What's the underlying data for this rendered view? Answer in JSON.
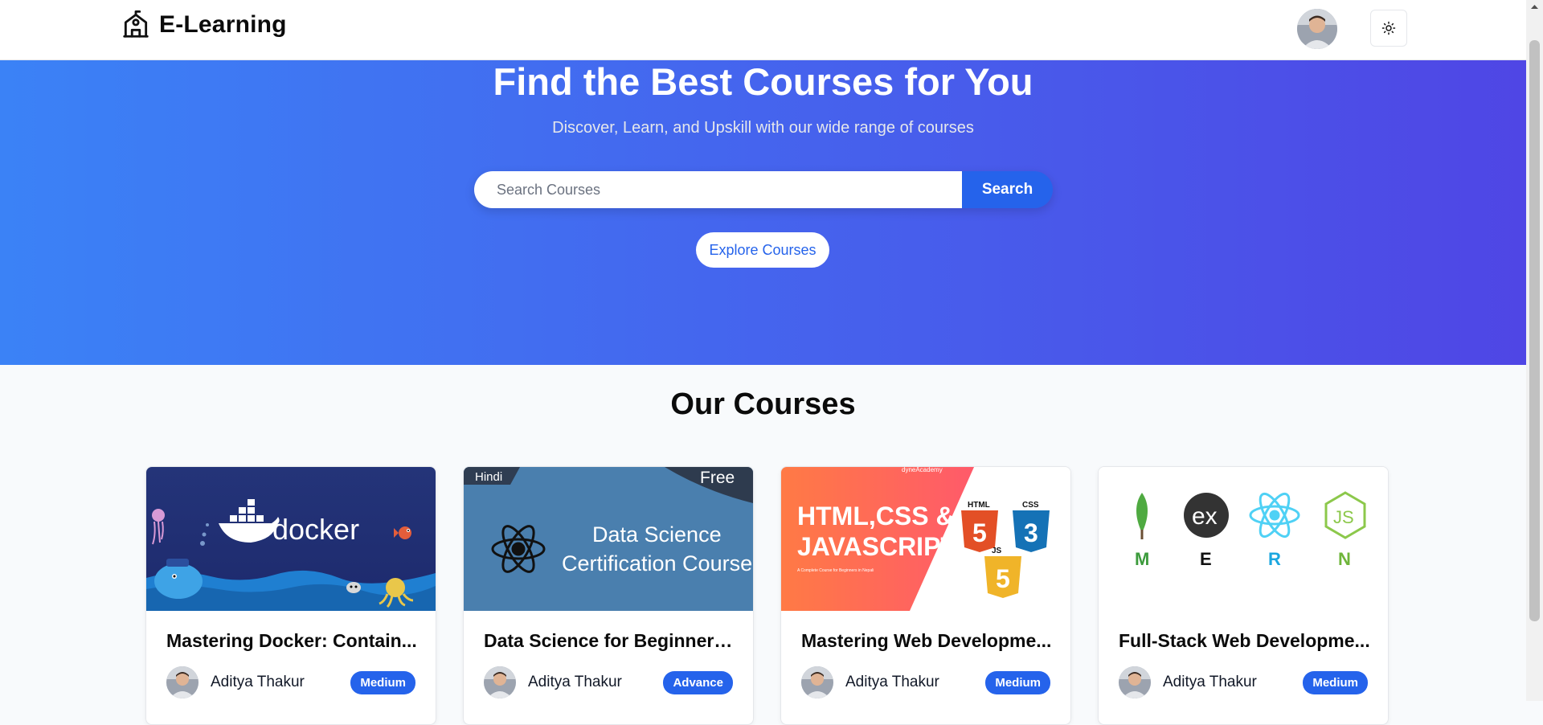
{
  "header": {
    "brand": "E-Learning",
    "avatar_icon": "user-avatar",
    "theme_icon": "sun-icon"
  },
  "hero": {
    "title": "Find the Best Courses for You",
    "subtitle": "Discover, Learn, and Upskill with our wide range of courses",
    "search_placeholder": "Search Courses",
    "search_button": "Search",
    "explore_button": "Explore Courses"
  },
  "courses": {
    "heading": "Our Courses",
    "items": [
      {
        "title": "Mastering Docker: Contain...",
        "author": "Aditya Thakur",
        "level": "Medium",
        "thumb": {
          "brand": "docker"
        }
      },
      {
        "title": "Data Science for Beginners:...",
        "author": "Aditya Thakur",
        "level": "Advance",
        "thumb": {
          "tag": "Hindi",
          "price": "Free",
          "line1": "Data Science",
          "line2": "Certification Course"
        }
      },
      {
        "title": "Mastering Web Developme...",
        "author": "Aditya Thakur",
        "level": "Medium",
        "thumb": {
          "brand": "dyneAcademy",
          "line1": "HTML,CSS &",
          "line2": "JAVASCRIPT",
          "caption": "A Complete Course for Beginners in Nepali",
          "html": "HTML",
          "css": "CSS",
          "js": "JS"
        }
      },
      {
        "title": "Full-Stack Web Developme...",
        "author": "Aditya Thakur",
        "level": "Medium",
        "thumb": {
          "letters": [
            "M",
            "E",
            "R",
            "N"
          ],
          "ex": "ex",
          "js": "JS"
        }
      }
    ]
  },
  "colors": {
    "primary": "#2563eb",
    "hero_from": "#3b82f6",
    "hero_to": "#4f46e5"
  }
}
